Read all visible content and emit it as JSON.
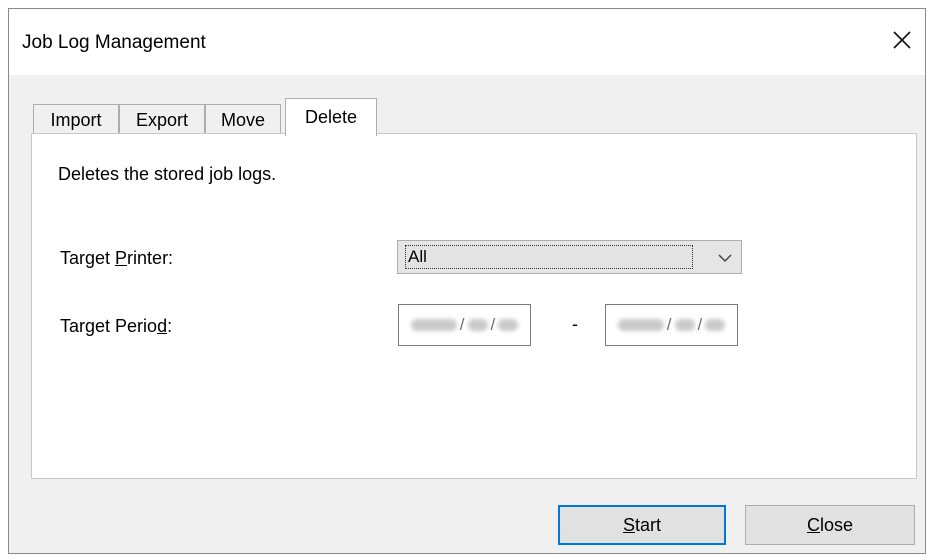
{
  "window": {
    "title": "Job Log Management"
  },
  "tabs": [
    {
      "label": "Import",
      "selected": false
    },
    {
      "label": "Export",
      "selected": false
    },
    {
      "label": "Move",
      "selected": false
    },
    {
      "label": "Delete",
      "selected": true
    }
  ],
  "panel": {
    "description": "Deletes the stored job logs.",
    "target_printer": {
      "label_before": "Target ",
      "label_mnemonic": "P",
      "label_after": "rinter:",
      "value": "All"
    },
    "target_period": {
      "label_before": "Target Perio",
      "label_mnemonic": "d",
      "label_after": ":",
      "date_separator": "/",
      "range_separator": "-"
    }
  },
  "buttons": {
    "start": {
      "mnemonic": "S",
      "rest": "tart"
    },
    "close": {
      "mnemonic": "C",
      "rest": "lose"
    }
  },
  "colors": {
    "dialog_bg": "#f0f0f0",
    "panel_bg": "#ffffff",
    "accent": "#0078d7"
  },
  "icons": {
    "close": "close-icon",
    "dropdown": "chevron-down-icon"
  }
}
